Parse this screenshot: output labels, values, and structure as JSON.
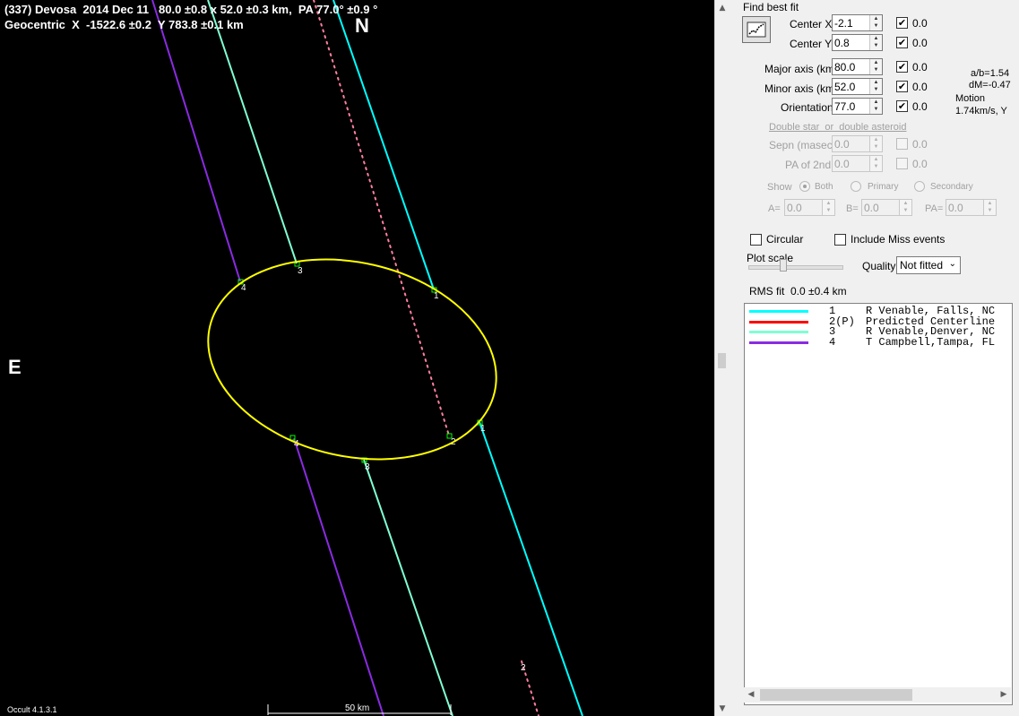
{
  "plot": {
    "title_line1": "(337) Devosa  2014 Dec 11   80.0 ±0.8 x 52.0 ±0.3 km,  PA 77.0° ±0.9 °",
    "title_line2": "Geocentric  X  -1522.6 ±0.2  Y 783.8 ±0.1 km",
    "north_label": "N",
    "east_label": "E",
    "version": "Occult 4.1.3.1",
    "scale_label": "50 km",
    "chord_labels": [
      "1",
      "2",
      "3",
      "4"
    ],
    "colors": {
      "background": "#000000",
      "ellipse": "#ffff00",
      "chord1": "#00ffff",
      "chord2": "#ff7f9f",
      "chord3": "#7fffd4",
      "chord4": "#8a2be2"
    }
  },
  "panel": {
    "find_best_fit": "Find best fit",
    "center_x": {
      "label": "Center X",
      "value": "-2.1",
      "checked": true,
      "extra": "0.0"
    },
    "center_y": {
      "label": "Center Y",
      "value": "0.8",
      "checked": true,
      "extra": "0.0"
    },
    "major_axis": {
      "label": "Major axis (km)",
      "value": "80.0",
      "checked": true,
      "extra": "0.0"
    },
    "minor_axis": {
      "label": "Minor axis (km)",
      "value": "52.0",
      "checked": true,
      "extra": "0.0"
    },
    "orientation": {
      "label": "Orientation",
      "value": "77.0",
      "checked": true,
      "extra": "0.0"
    },
    "ab_ratio": "a/b=1.54",
    "dm": "dM=-0.47",
    "motion_label": "Motion",
    "motion_value": "1.74km/s, Y",
    "double_star_link": "Double star  or  double asteroid",
    "sepn": {
      "label": "Sepn (masec)",
      "value": "0.0",
      "extra": "0.0"
    },
    "pa2nd": {
      "label": "PA of 2nd",
      "value": "0.0",
      "extra": "0.0"
    },
    "show_label": "Show",
    "radio_both": "Both",
    "radio_primary": "Primary",
    "radio_secondary": "Secondary",
    "a_label": "A=",
    "a_value": "0.0",
    "b_label": "B=",
    "b_value": "0.0",
    "pa_label": "PA=",
    "pa_value": "0.0",
    "circular": "Circular",
    "include_miss": "Include Miss events",
    "plot_scale": "Plot scale",
    "quality_label": "Quality",
    "quality_value": "Not fitted",
    "rms_fit": "RMS fit  0.0 ±0.4 km",
    "legend": [
      {
        "num": "1",
        "text": "R Venable, Falls, NC",
        "color": "#00ffff"
      },
      {
        "num": "2(P)",
        "text": "Predicted Centerline",
        "color": "#ff0000"
      },
      {
        "num": "3",
        "text": "R Venable,Denver, NC",
        "color": "#7fffd4"
      },
      {
        "num": "4",
        "text": "T Campbell,Tampa, FL",
        "color": "#8a2be2"
      }
    ]
  }
}
